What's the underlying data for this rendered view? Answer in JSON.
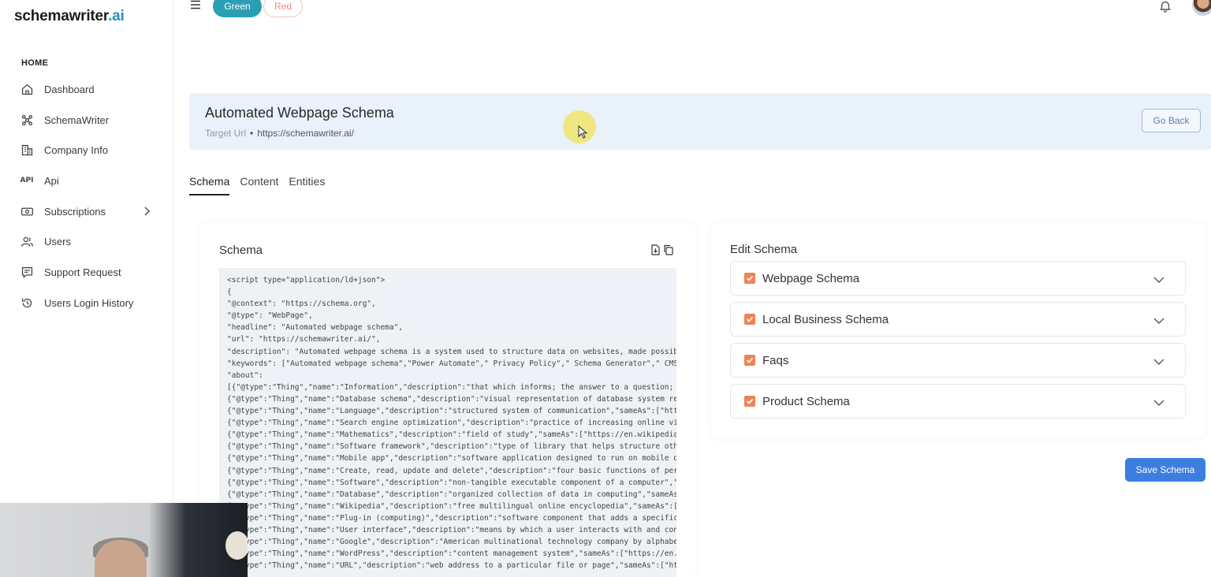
{
  "app": {
    "logo_main": "schemawriter",
    "logo_suffix": ".ai"
  },
  "sidebar": {
    "section_label": "HOME",
    "items": [
      {
        "label": "Dashboard",
        "icon": "home-icon"
      },
      {
        "label": "SchemaWriter",
        "icon": "schema-icon"
      },
      {
        "label": "Company Info",
        "icon": "building-icon"
      },
      {
        "label": "Api",
        "icon": "api-icon",
        "icon_text": "API"
      },
      {
        "label": "Subscriptions",
        "icon": "subscription-icon",
        "has_submenu": true
      },
      {
        "label": "Users",
        "icon": "users-icon"
      },
      {
        "label": "Support Request",
        "icon": "support-icon"
      },
      {
        "label": "Users Login History",
        "icon": "history-icon"
      }
    ]
  },
  "topbar": {
    "theme_green": "Green",
    "theme_red": "Red"
  },
  "banner": {
    "title": "Automated Webpage Schema",
    "target_label": "Target Url",
    "target_url": "https://schemawriter.ai/",
    "go_back": "Go Back"
  },
  "tabs": [
    "Schema",
    "Content",
    "Entities"
  ],
  "schema": {
    "title": "Schema",
    "code_lines": [
      "<script type=\"application/ld+json\">",
      "{",
      "\"@context\": \"https://schema.org\",",
      "\"@type\": \"WebPage\",",
      "\"headline\": \"Automated webpage schema\",",
      "\"url\": \"https://schemawriter.ai/\",",
      "\"description\": \"Automated webpage schema is a system used to structure data on websites, made possible",
      "\"keywords\": [\"Automated webpage schema\",\"Power Automate\",\" Privacy Policy\",\" Schema Generator\",\" CMS AP",
      "\"about\":",
      "[{\"@type\":\"Thing\",\"name\":\"Information\",\"description\":\"that which informs; the answer to a question; tha",
      "{\"@type\":\"Thing\",\"name\":\"Database schema\",\"description\":\"visual representation of database system relat",
      "{\"@type\":\"Thing\",\"name\":\"Language\",\"description\":\"structured system of communication\",\"sameAs\":[\"https:",
      "{\"@type\":\"Thing\",\"name\":\"Search engine optimization\",\"description\":\"practice of increasing online visib",
      "{\"@type\":\"Thing\",\"name\":\"Mathematics\",\"description\":\"field of study\",\"sameAs\":[\"https://en.wikipedia.or",
      "{\"@type\":\"Thing\",\"name\":\"Software framework\",\"description\":\"type of library that helps structure other",
      "{\"@type\":\"Thing\",\"name\":\"Mobile app\",\"description\":\"software application designed to run on mobile devi",
      "{\"@type\":\"Thing\",\"name\":\"Create, read, update and delete\",\"description\":\"four basic functions of persis",
      "{\"@type\":\"Thing\",\"name\":\"Software\",\"description\":\"non-tangible executable component of a computer\",\"sam",
      "{\"@type\":\"Thing\",\"name\":\"Database\",\"description\":\"organized collection of data in computing\",\"sameAs\":[",
      "{\"@type\":\"Thing\",\"name\":\"Wikipedia\",\"description\":\"free multilingual online encyclopedia\",\"sameAs\":[\"ht",
      "{\"@type\":\"Thing\",\"name\":\"Plug-in (computing)\",\"description\":\"software component that adds a specific fe",
      "{\"@type\":\"Thing\",\"name\":\"User interface\",\"description\":\"means by which a user interacts with and contro",
      "{\"@type\":\"Thing\",\"name\":\"Google\",\"description\":\"American multinational technology company by alphabet i",
      "{\"@type\":\"Thing\",\"name\":\"WordPress\",\"description\":\"content management system\",\"sameAs\":[\"https://en.wik",
      "{\"@type\":\"Thing\",\"name\":\"URL\",\"description\":\"web address to a particular file or page\",\"sameAs\":[\"https"
    ]
  },
  "edit_schema": {
    "title": "Edit Schema",
    "items": [
      {
        "label": "Webpage Schema",
        "checked": true
      },
      {
        "label": "Local Business Schema",
        "checked": true
      },
      {
        "label": "Faqs",
        "checked": true
      },
      {
        "label": "Product Schema",
        "checked": true
      }
    ],
    "save_label": "Save Schema"
  },
  "colors": {
    "accent_green": "#2a9fb3",
    "banner_bg": "#e9f1fb",
    "checkbox_orange": "#ef8356",
    "save_blue": "#3c7ee0"
  }
}
